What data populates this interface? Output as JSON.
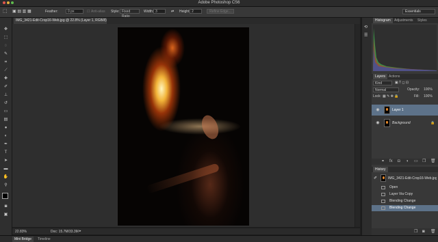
{
  "app_title": "Adobe Photoshop CS6",
  "options": {
    "feather_label": "Feather:",
    "feather_value": "0 px",
    "antialias_label": "Anti-alias",
    "style_label": "Style:",
    "style_value": "Fixed Ratio",
    "width_label": "Width:",
    "width_value": "3",
    "height_label": "Height:",
    "height_value": "2",
    "refine_label": "Refine Edge...",
    "workspace": "Essentials"
  },
  "document": {
    "tab_label": "IMG_3421-Edit-Crop16-Web.jpg @ 22.8% (Layer 1, RGB/8) *",
    "zoom": "22.83%",
    "doc_info": "Doc: 15.7M/33.3M"
  },
  "bottom_tabs": [
    "Mini Bridge",
    "Timeline"
  ],
  "histogram_panel": {
    "tabs": [
      "Histogram",
      "Adjustments",
      "Styles"
    ]
  },
  "layers_panel": {
    "tabs": [
      "Layers",
      "Actions"
    ],
    "kind": "Kind",
    "blend": "Normal",
    "opacity_label": "Opacity:",
    "opacity": "100%",
    "lock_label": "Lock:",
    "fill_label": "Fill:",
    "fill": "100%",
    "layers": [
      "Layer 1",
      "Background"
    ]
  },
  "history_panel": {
    "tab": "History",
    "snapshot": "IMG_3421-Edit-Crop16-Web.jpg",
    "items": [
      "Open",
      "Layer Via Copy",
      "Blending Change",
      "Blending Change"
    ]
  },
  "colors": {
    "accent_selected": "#5d7289",
    "panel_bg": "#383838",
    "app_bg": "#1e1e1e"
  }
}
